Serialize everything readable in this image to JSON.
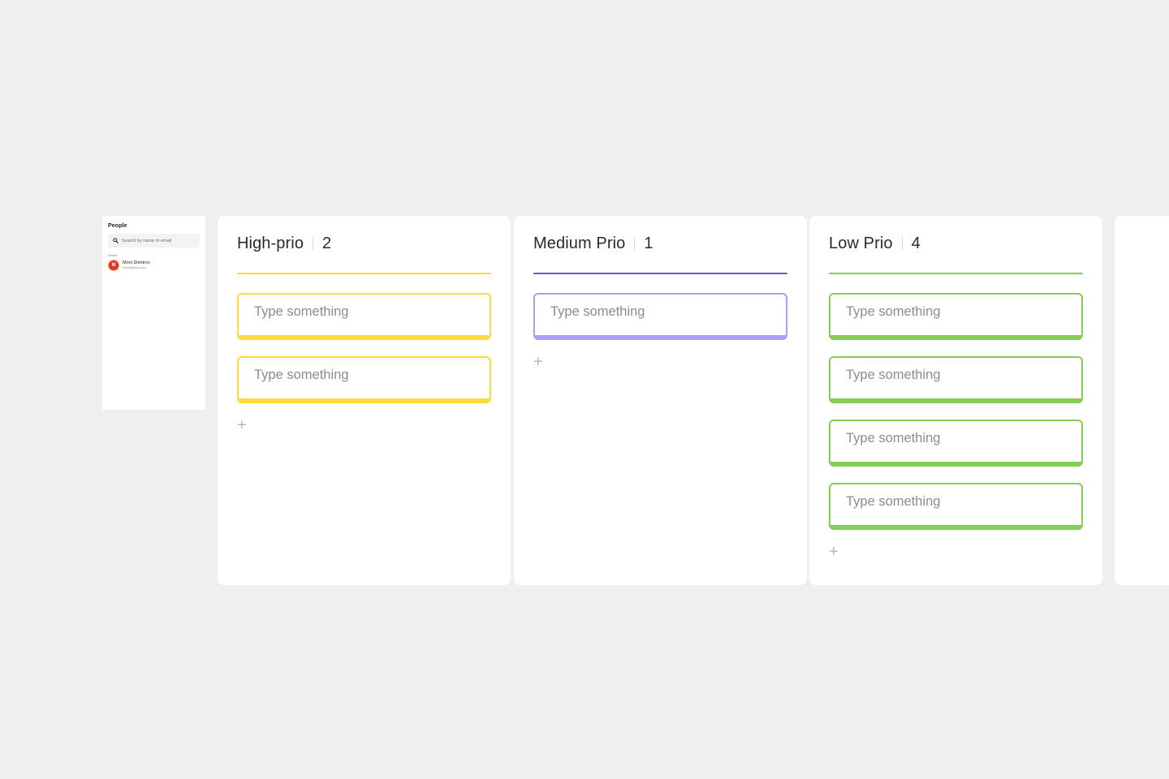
{
  "people_panel": {
    "title": "People",
    "search_placeholder": "Search by name or email",
    "online_label": "Online",
    "users": [
      {
        "initial": "M",
        "name": "Moni Dimitrov",
        "email": "mony@miro.com"
      }
    ]
  },
  "columns": [
    {
      "title": "High-prio",
      "count": "2",
      "accent": "#fddb3a",
      "cards": [
        "Type something",
        "Type something"
      ],
      "add_label": "+"
    },
    {
      "title": "Medium Prio",
      "count": "1",
      "accent_line": "#5b5fc7",
      "accent": "#a99ff5",
      "cards": [
        "Type something"
      ],
      "add_label": "+"
    },
    {
      "title": "Low Prio",
      "count": "4",
      "accent": "#86cd52",
      "cards": [
        "Type something",
        "Type something",
        "Type something",
        "Type something"
      ],
      "add_label": "+"
    }
  ]
}
